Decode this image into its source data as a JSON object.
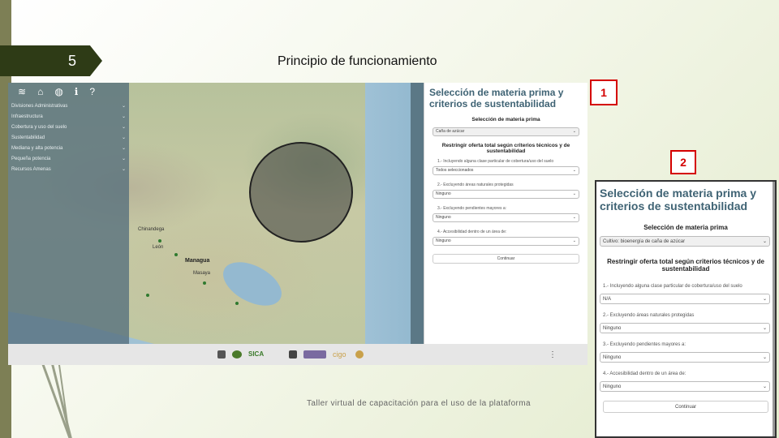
{
  "slide": {
    "number": "5",
    "title": "Principio de funcionamiento",
    "footer": "Taller virtual de capacitación para el uso de la plataforma"
  },
  "markers": [
    "1",
    "2"
  ],
  "map_app": {
    "toolbar_icons": [
      "layers-icon",
      "home-icon",
      "globe-icon",
      "info-icon",
      "help-icon"
    ],
    "toolbar_glyphs": [
      "≋",
      "⌂",
      "◍",
      "ℹ",
      "?"
    ],
    "sidebar_items": [
      "Divisiones Administrativas",
      "Infraestructura",
      "Cobertura y uso del suelo",
      "Sustentabilidad",
      "Mediana y alta potencia",
      "Pequeña potencia",
      "Recursos Amenas"
    ],
    "map_labels": [
      "Managua",
      "Chinandega",
      "León",
      "Masaya"
    ],
    "bottom_logos": [
      "SICA",
      "cigo"
    ]
  },
  "panel": {
    "title": "Selección de materia prima y criterios de sustentabilidad",
    "section1": "Selección de materia prima",
    "feedstock_value": "Caña de azúcar",
    "section2": "Restringir oferta total según criterios técnicos y de sustentabilidad",
    "criteria": [
      {
        "label": "1.- Incluyendo alguna clase particular de cobertura/uso del suelo",
        "value": "Todos seleccionados"
      },
      {
        "label": "2.- Excluyendo áreas naturales protegidas",
        "value": "Ninguno"
      },
      {
        "label": "3.- Excluyendo pendientes mayores a:",
        "value": "Ninguno"
      },
      {
        "label": "4.- Accesibilidad dentro de un área de:",
        "value": "Ninguno"
      }
    ],
    "continue_label": "Continuar"
  },
  "zoom_panel": {
    "title": "Selección de materia prima y criterios de sustentabilidad",
    "section1": "Selección de materia prima",
    "feedstock_value": "Cultivo: bioenergía de caña de azúcar",
    "section2": "Restringir oferta total según criterios técnicos y de sustentabilidad",
    "criteria": [
      {
        "label": "1.- Incluyendo alguna clase particular de cobertura/uso del suelo",
        "value": "N/A"
      },
      {
        "label": "2.- Excluyendo áreas naturales protegidas",
        "value": "Ninguno"
      },
      {
        "label": "3.- Excluyendo pendientes mayores a:",
        "value": "Ninguno"
      },
      {
        "label": "4.- Accesibilidad dentro de un área de:",
        "value": "Ninguno"
      }
    ],
    "continue_label": "Continuar"
  }
}
